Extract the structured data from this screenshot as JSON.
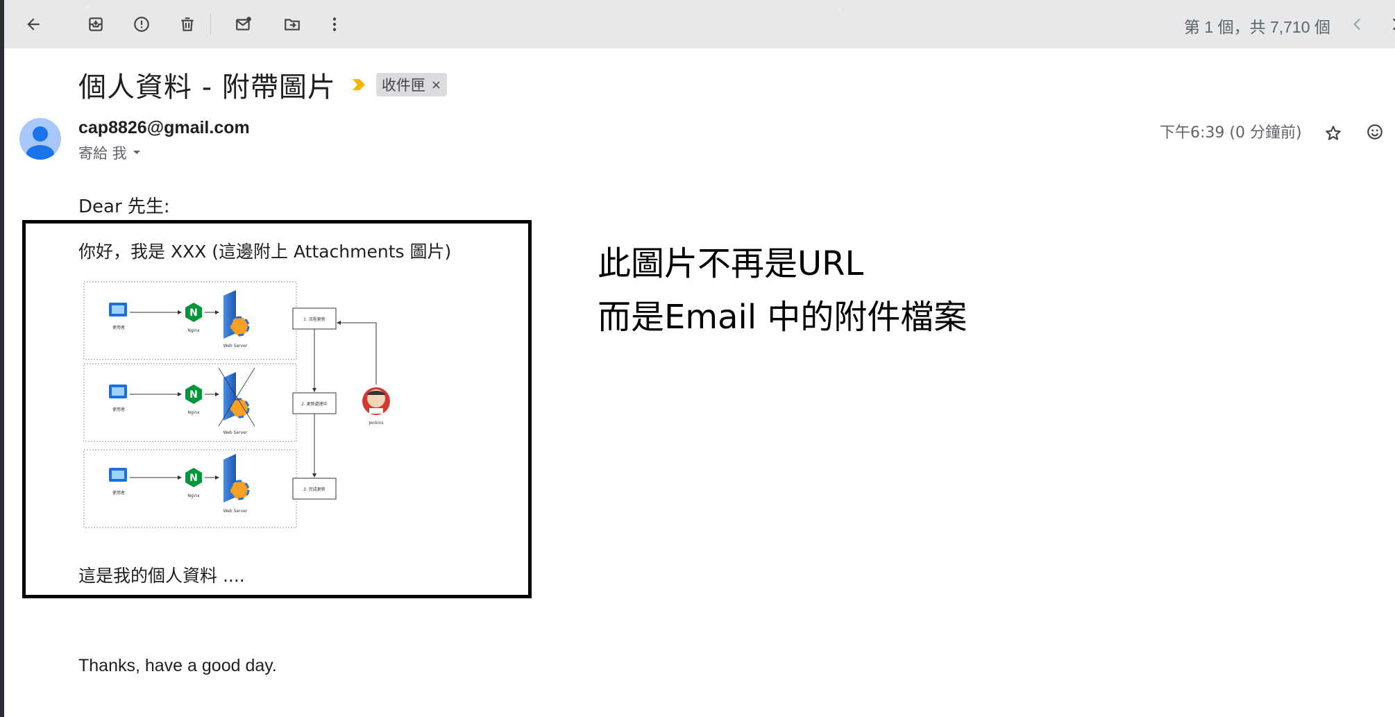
{
  "toolbar": {
    "buttons": [
      {
        "name": "back-button",
        "icon": "arrow-left-icon"
      },
      {
        "name": "archive-button",
        "icon": "archive-icon"
      },
      {
        "name": "report-spam-button",
        "icon": "alert-circle-icon"
      },
      {
        "name": "delete-button",
        "icon": "trash-icon"
      },
      {
        "name": "mark-unread-button",
        "icon": "mail-unread-icon"
      },
      {
        "name": "move-to-button",
        "icon": "folder-move-icon"
      },
      {
        "name": "more-button",
        "icon": "more-vertical-icon"
      }
    ],
    "pager": "第 1 個，共 7,710 個"
  },
  "email": {
    "subject": "個人資料 - 附帶圖片",
    "label": "收件匣",
    "label_remove": "×",
    "sender": "cap8826@gmail.com",
    "recipient": "寄給 我",
    "timestamp": "下午6:39 (0 分鐘前)",
    "greeting": "Dear 先生:",
    "intro": "你好，我是 XXX (這邊附上 Attachments 圖片)",
    "closing_note": "這是我的個人資料 ....",
    "signoff": "Thanks, have a good day."
  },
  "annotation": {
    "line1": "此圖片不再是URL",
    "line2": "而是Email 中的附件檔案"
  },
  "diagram": {
    "user_label": "使用者",
    "nginx_label": "Nginx",
    "server_label": "Web Server",
    "steps": [
      "1. 流程更新",
      "2. 更新處理中",
      "3. 完成更新"
    ],
    "jenkins_label": "Jenkins"
  },
  "colors": {
    "toolbar_bg": "#e6e8ea",
    "label_chip": "#dadce0",
    "importance_marker": "#f4b400",
    "avatar_bg": "#a8c7fa",
    "avatar_fg": "#1a73e8",
    "nginx_green": "#009639"
  }
}
